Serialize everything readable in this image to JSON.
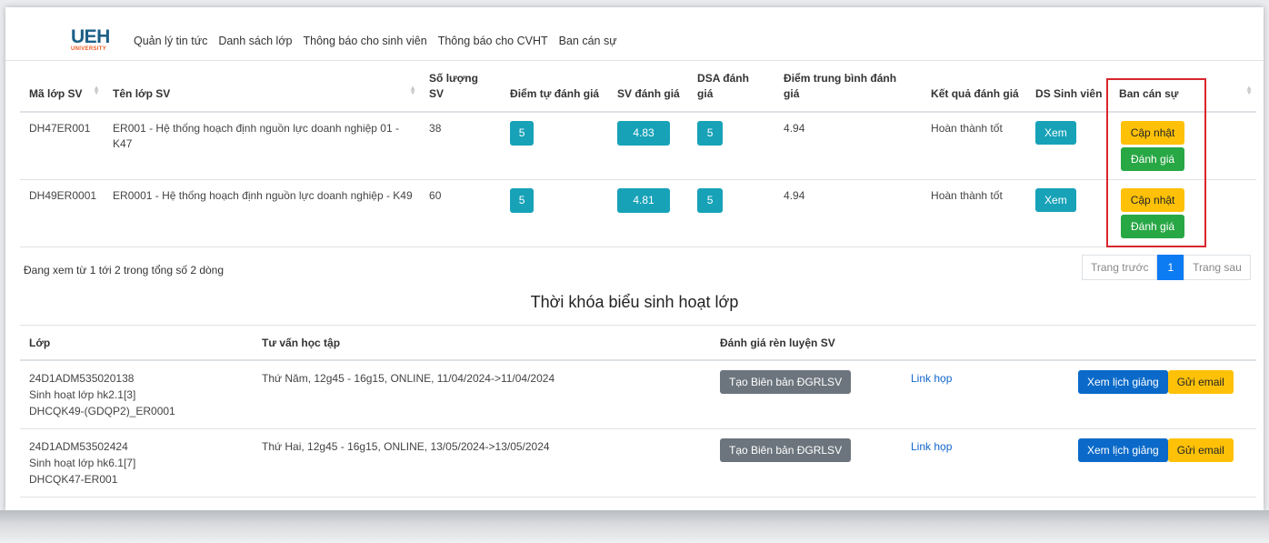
{
  "brand": {
    "logo_main": "UEH",
    "logo_sub": "UNIVERSITY"
  },
  "nav": [
    "Quản lý tin tức",
    "Danh sách lớp",
    "Thông báo cho sinh viên",
    "Thông báo cho CVHT",
    "Ban cán sự"
  ],
  "class_table": {
    "headers": [
      "Mã lớp SV",
      "Tên lớp SV",
      "Số lượng SV",
      "Điểm tự đánh giá",
      "SV đánh giá",
      "DSA đánh giá",
      "Điểm trung bình đánh giá",
      "Kết quả đánh giá",
      "DS Sinh viên",
      "Ban cán sự"
    ],
    "rows": [
      {
        "code": "DH47ER001",
        "name": "ER001 - Hệ thống hoạch định nguồn lực doanh nghiệp 01 - K47",
        "count": "38",
        "self_score": "5",
        "sv_score": "4.83",
        "dsa_score": "5",
        "avg": "4.94",
        "result": "Hoàn thành tốt",
        "view_label": "Xem",
        "update_label": "Cập nhật",
        "eval_label": "Đánh giá"
      },
      {
        "code": "DH49ER0001",
        "name": "ER0001 - Hệ thống hoạch định nguồn lực doanh nghiệp - K49",
        "count": "60",
        "self_score": "5",
        "sv_score": "4.81",
        "dsa_score": "5",
        "avg": "4.94",
        "result": "Hoàn thành tốt",
        "view_label": "Xem",
        "update_label": "Cập nhật",
        "eval_label": "Đánh giá"
      }
    ]
  },
  "table_info": "Đang xem từ 1 tới 2 trong tổng số 2 dòng",
  "pagination": {
    "prev": "Trang trước",
    "current": "1",
    "next": "Trang sau"
  },
  "schedule_title": "Thời khóa biểu sinh hoạt lớp",
  "schedule_table": {
    "headers": [
      "Lớp",
      "Tư vấn học tập",
      "Đánh giá rèn luyện SV"
    ],
    "rows": [
      {
        "class_lines": [
          "24D1ADM535020138",
          "Sinh hoạt lớp hk2.1[3]",
          "DHCQK49-(GDQP2)_ER0001"
        ],
        "schedule": "Thứ Năm, 12g45 - 16g15, ONLINE, 11/04/2024->11/04/2024",
        "create_label": "Tạo Biên bản ĐGRLSV",
        "link_label": "Link họp",
        "view_label": "Xem lịch giảng",
        "email_label": "Gửi email"
      },
      {
        "class_lines": [
          "24D1ADM53502424",
          "Sinh hoạt lớp hk6.1[7]",
          "DHCQK47-ER001"
        ],
        "schedule": "Thứ Hai, 12g45 - 16g15, ONLINE, 13/05/2024->13/05/2024",
        "create_label": "Tạo Biên bản ĐGRLSV",
        "link_label": "Link họp",
        "view_label": "Xem lịch giảng",
        "email_label": "Gửi email"
      }
    ]
  },
  "colors": {
    "info": "#17a2b8",
    "warning": "#ffc107",
    "success": "#28a745",
    "secondary": "#6c757d",
    "primary": "#0b6ac9",
    "highlight_border": "#d9262c"
  }
}
